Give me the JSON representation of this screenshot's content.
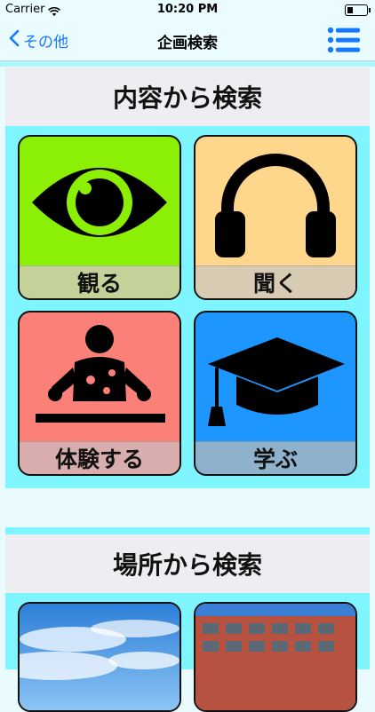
{
  "status_bar": {
    "carrier": "Carrier",
    "time": "10:20 PM"
  },
  "nav": {
    "back_label": "その他",
    "title": "企画検索"
  },
  "content_section": {
    "heading": "内容から検索",
    "tiles": [
      {
        "label": "観る",
        "icon": "eye-icon",
        "color": "#8cf006",
        "label_bg": "#c4d29a"
      },
      {
        "label": "聞く",
        "icon": "headphones-icon",
        "color": "#ffd78c",
        "label_bg": "#d8cbb4"
      },
      {
        "label": "体験する",
        "icon": "hands-on-person-icon",
        "color": "#fa8078",
        "label_bg": "#d7aead"
      },
      {
        "label": "学ぶ",
        "icon": "graduation-cap-icon",
        "color": "#1e96ff",
        "label_bg": "#8fb2cc"
      }
    ]
  },
  "place_section": {
    "heading": "場所から検索",
    "tiles": [
      {
        "image": "sky-photo"
      },
      {
        "image": "building-photo"
      }
    ]
  },
  "colors": {
    "accent": "#1677ff",
    "panel": "#7ff6ff",
    "background": "#e9fbff"
  }
}
